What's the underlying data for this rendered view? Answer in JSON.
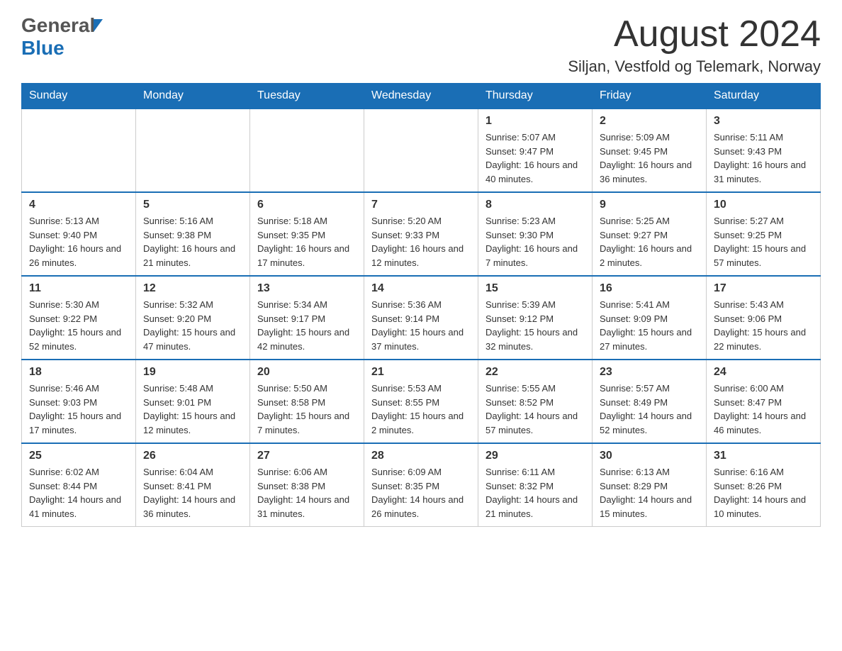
{
  "header": {
    "logo_general": "General",
    "logo_blue": "Blue",
    "month_year": "August 2024",
    "location": "Siljan, Vestfold og Telemark, Norway"
  },
  "days_of_week": [
    "Sunday",
    "Monday",
    "Tuesday",
    "Wednesday",
    "Thursday",
    "Friday",
    "Saturday"
  ],
  "weeks": [
    [
      {
        "day": "",
        "info": ""
      },
      {
        "day": "",
        "info": ""
      },
      {
        "day": "",
        "info": ""
      },
      {
        "day": "",
        "info": ""
      },
      {
        "day": "1",
        "info": "Sunrise: 5:07 AM\nSunset: 9:47 PM\nDaylight: 16 hours and 40 minutes."
      },
      {
        "day": "2",
        "info": "Sunrise: 5:09 AM\nSunset: 9:45 PM\nDaylight: 16 hours and 36 minutes."
      },
      {
        "day": "3",
        "info": "Sunrise: 5:11 AM\nSunset: 9:43 PM\nDaylight: 16 hours and 31 minutes."
      }
    ],
    [
      {
        "day": "4",
        "info": "Sunrise: 5:13 AM\nSunset: 9:40 PM\nDaylight: 16 hours and 26 minutes."
      },
      {
        "day": "5",
        "info": "Sunrise: 5:16 AM\nSunset: 9:38 PM\nDaylight: 16 hours and 21 minutes."
      },
      {
        "day": "6",
        "info": "Sunrise: 5:18 AM\nSunset: 9:35 PM\nDaylight: 16 hours and 17 minutes."
      },
      {
        "day": "7",
        "info": "Sunrise: 5:20 AM\nSunset: 9:33 PM\nDaylight: 16 hours and 12 minutes."
      },
      {
        "day": "8",
        "info": "Sunrise: 5:23 AM\nSunset: 9:30 PM\nDaylight: 16 hours and 7 minutes."
      },
      {
        "day": "9",
        "info": "Sunrise: 5:25 AM\nSunset: 9:27 PM\nDaylight: 16 hours and 2 minutes."
      },
      {
        "day": "10",
        "info": "Sunrise: 5:27 AM\nSunset: 9:25 PM\nDaylight: 15 hours and 57 minutes."
      }
    ],
    [
      {
        "day": "11",
        "info": "Sunrise: 5:30 AM\nSunset: 9:22 PM\nDaylight: 15 hours and 52 minutes."
      },
      {
        "day": "12",
        "info": "Sunrise: 5:32 AM\nSunset: 9:20 PM\nDaylight: 15 hours and 47 minutes."
      },
      {
        "day": "13",
        "info": "Sunrise: 5:34 AM\nSunset: 9:17 PM\nDaylight: 15 hours and 42 minutes."
      },
      {
        "day": "14",
        "info": "Sunrise: 5:36 AM\nSunset: 9:14 PM\nDaylight: 15 hours and 37 minutes."
      },
      {
        "day": "15",
        "info": "Sunrise: 5:39 AM\nSunset: 9:12 PM\nDaylight: 15 hours and 32 minutes."
      },
      {
        "day": "16",
        "info": "Sunrise: 5:41 AM\nSunset: 9:09 PM\nDaylight: 15 hours and 27 minutes."
      },
      {
        "day": "17",
        "info": "Sunrise: 5:43 AM\nSunset: 9:06 PM\nDaylight: 15 hours and 22 minutes."
      }
    ],
    [
      {
        "day": "18",
        "info": "Sunrise: 5:46 AM\nSunset: 9:03 PM\nDaylight: 15 hours and 17 minutes."
      },
      {
        "day": "19",
        "info": "Sunrise: 5:48 AM\nSunset: 9:01 PM\nDaylight: 15 hours and 12 minutes."
      },
      {
        "day": "20",
        "info": "Sunrise: 5:50 AM\nSunset: 8:58 PM\nDaylight: 15 hours and 7 minutes."
      },
      {
        "day": "21",
        "info": "Sunrise: 5:53 AM\nSunset: 8:55 PM\nDaylight: 15 hours and 2 minutes."
      },
      {
        "day": "22",
        "info": "Sunrise: 5:55 AM\nSunset: 8:52 PM\nDaylight: 14 hours and 57 minutes."
      },
      {
        "day": "23",
        "info": "Sunrise: 5:57 AM\nSunset: 8:49 PM\nDaylight: 14 hours and 52 minutes."
      },
      {
        "day": "24",
        "info": "Sunrise: 6:00 AM\nSunset: 8:47 PM\nDaylight: 14 hours and 46 minutes."
      }
    ],
    [
      {
        "day": "25",
        "info": "Sunrise: 6:02 AM\nSunset: 8:44 PM\nDaylight: 14 hours and 41 minutes."
      },
      {
        "day": "26",
        "info": "Sunrise: 6:04 AM\nSunset: 8:41 PM\nDaylight: 14 hours and 36 minutes."
      },
      {
        "day": "27",
        "info": "Sunrise: 6:06 AM\nSunset: 8:38 PM\nDaylight: 14 hours and 31 minutes."
      },
      {
        "day": "28",
        "info": "Sunrise: 6:09 AM\nSunset: 8:35 PM\nDaylight: 14 hours and 26 minutes."
      },
      {
        "day": "29",
        "info": "Sunrise: 6:11 AM\nSunset: 8:32 PM\nDaylight: 14 hours and 21 minutes."
      },
      {
        "day": "30",
        "info": "Sunrise: 6:13 AM\nSunset: 8:29 PM\nDaylight: 14 hours and 15 minutes."
      },
      {
        "day": "31",
        "info": "Sunrise: 6:16 AM\nSunset: 8:26 PM\nDaylight: 14 hours and 10 minutes."
      }
    ]
  ]
}
